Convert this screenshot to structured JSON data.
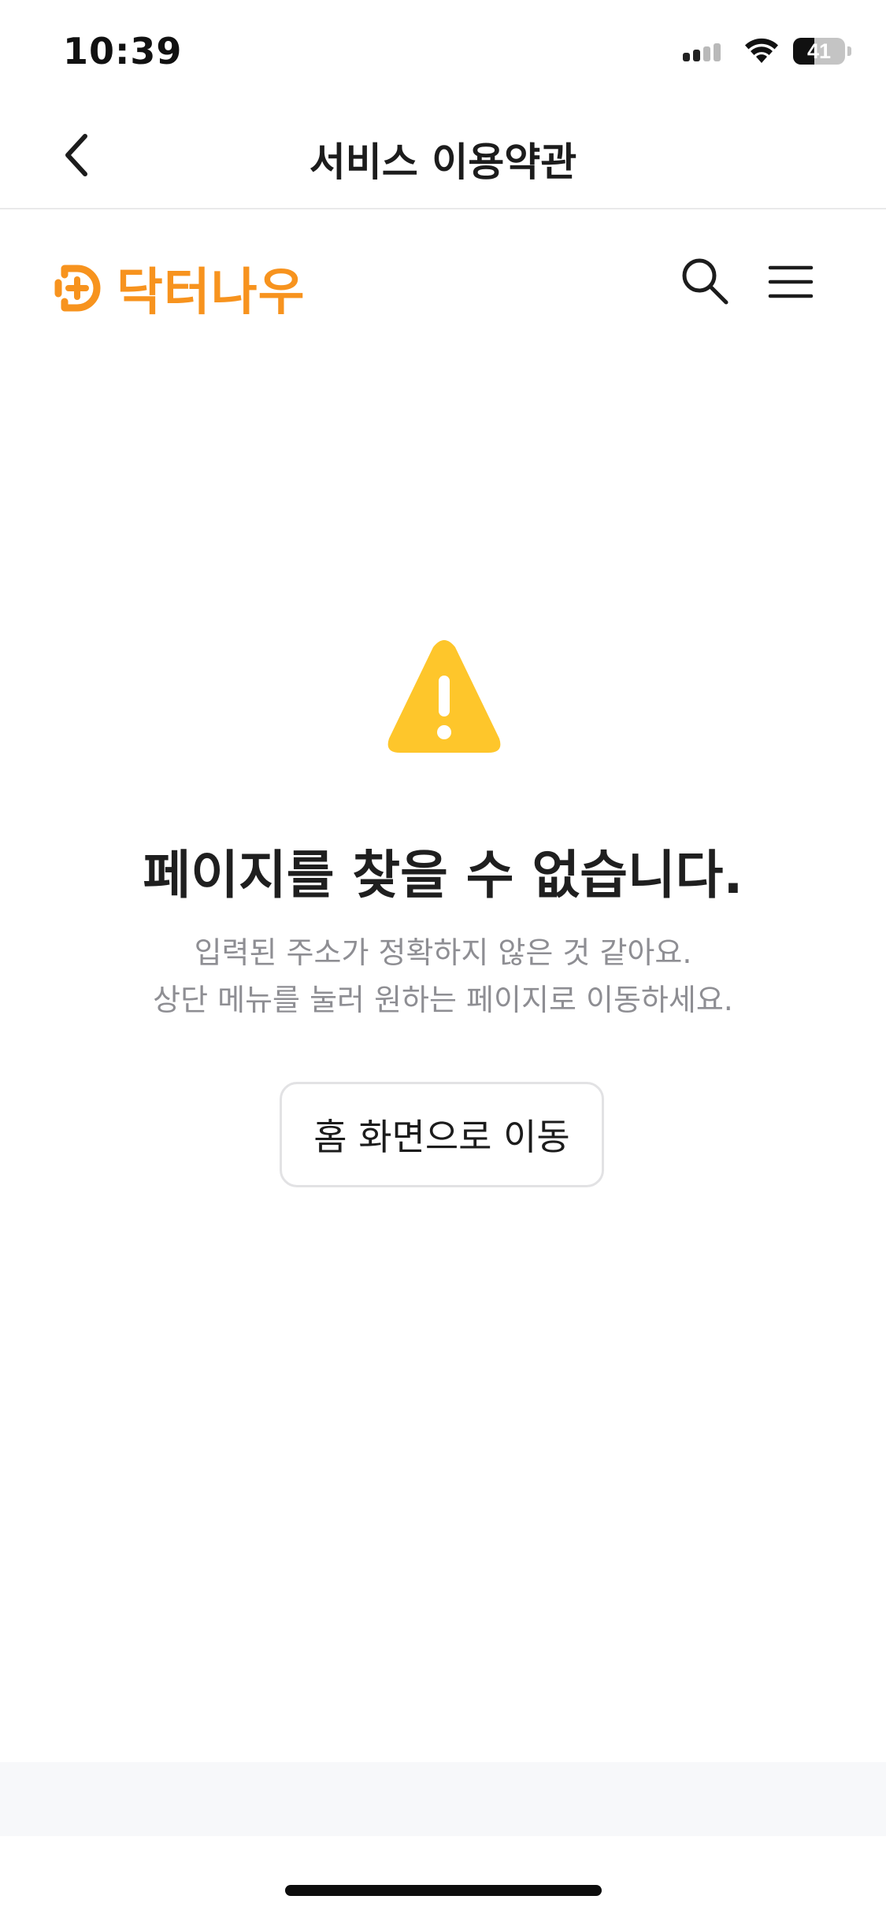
{
  "status_bar": {
    "time": "10:39",
    "battery_level": "41"
  },
  "nav": {
    "title": "서비스 이용약관",
    "back_icon": "chevron-left-icon"
  },
  "header": {
    "logo_text": "닥터나우",
    "logo_icon": "doctornow-logo-icon",
    "search_icon": "search-icon",
    "menu_icon": "hamburger-menu-icon"
  },
  "error": {
    "icon": "warning-triangle-icon",
    "title": "페이지를 찾을 수 없습니다.",
    "line1": "입력된 주소가 정확하지 않은 것 같아요.",
    "line2": "상단 메뉴를 눌러 원하는 페이지로 이동하세요."
  },
  "home_button": {
    "label": "홈 화면으로 이동"
  },
  "colors": {
    "brand": "#f7931e",
    "warning": "#fec62b",
    "muted_text": "#8e8e93"
  }
}
